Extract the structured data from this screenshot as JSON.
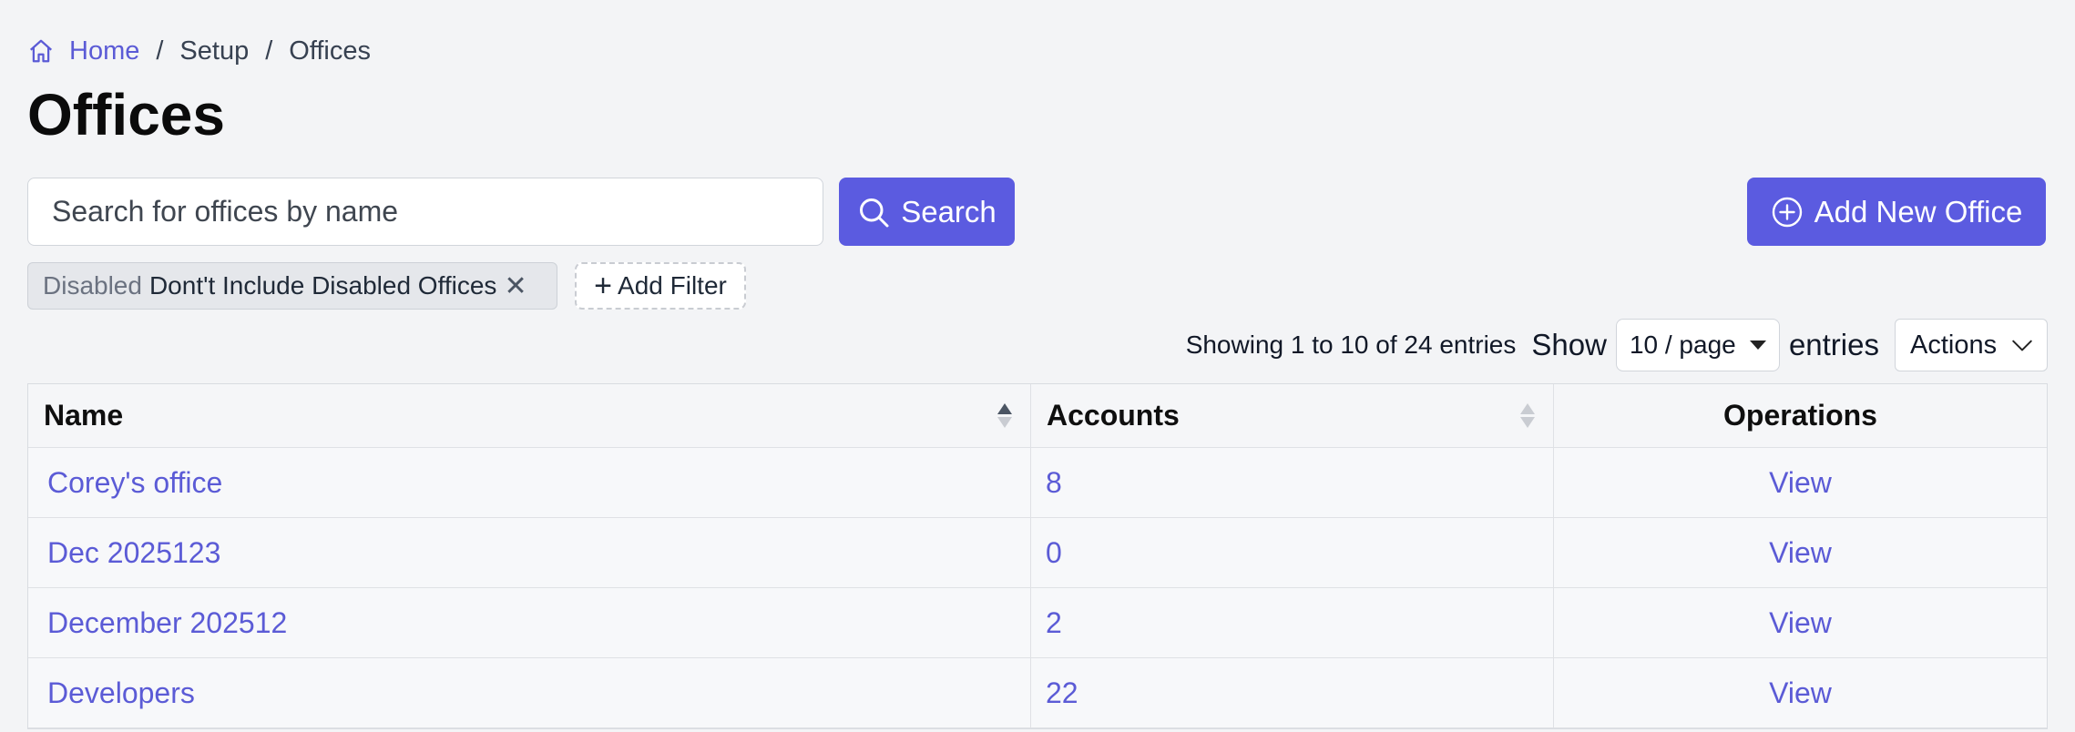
{
  "breadcrumb": {
    "home": "Home",
    "setup": "Setup",
    "current": "Offices"
  },
  "page_title": "Offices",
  "search": {
    "placeholder": "Search for offices by name",
    "value": "",
    "button": "Search"
  },
  "add_button": "Add New Office",
  "filters": [
    {
      "key": "Disabled",
      "value": "Dont't Include Disabled Offices"
    }
  ],
  "add_filter": "Add Filter",
  "pager": {
    "showing": "Showing 1 to 10 of 24 entries",
    "show": "Show",
    "page_size": "10 / page",
    "entries": "entries",
    "actions": "Actions"
  },
  "table": {
    "headers": {
      "name": "Name",
      "accounts": "Accounts",
      "operations": "Operations"
    },
    "rows": [
      {
        "name": "Corey's office",
        "accounts": "8",
        "op": "View"
      },
      {
        "name": "Dec 2025123",
        "accounts": "0",
        "op": "View"
      },
      {
        "name": "December 202512",
        "accounts": "2",
        "op": "View"
      },
      {
        "name": "Developers",
        "accounts": "22",
        "op": "View"
      }
    ]
  },
  "colors": {
    "accent": "#5b5be0",
    "link": "#5b5bd6",
    "background": "#f3f4f6"
  }
}
